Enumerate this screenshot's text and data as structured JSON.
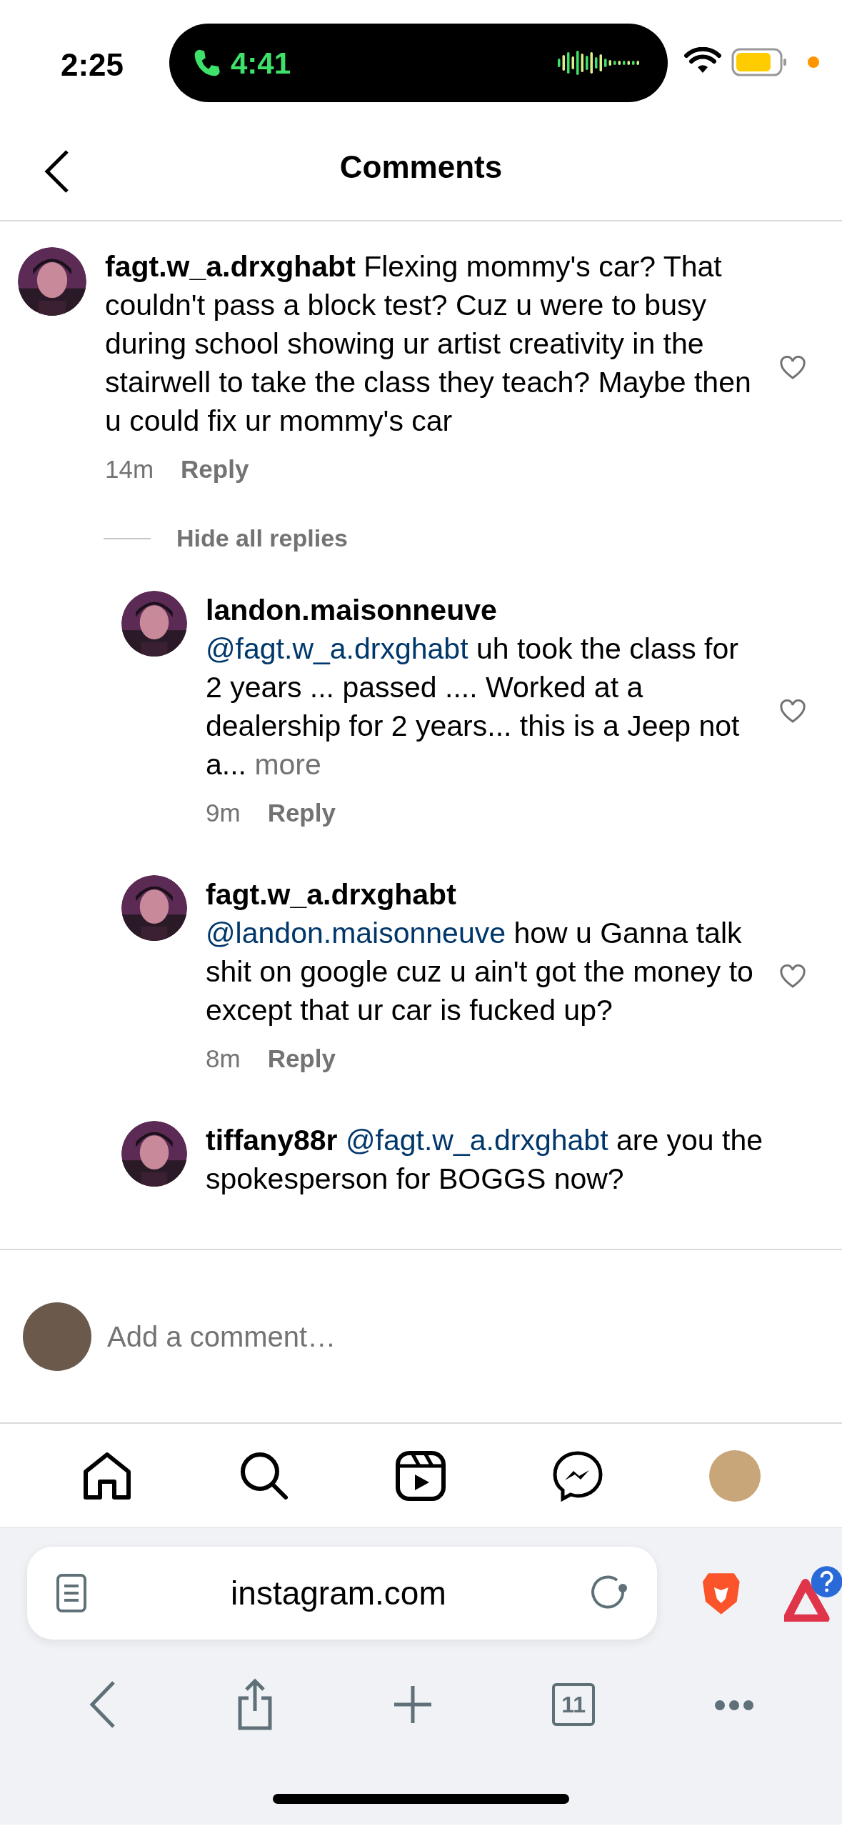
{
  "status_bar": {
    "time": "2:25",
    "call_timer": "4:41"
  },
  "header": {
    "title": "Comments"
  },
  "comments": [
    {
      "kind": "inline",
      "username": "fagt.w_a.drxghabt",
      "text": "Flexing mommy's car? That couldn't pass a block test? Cuz u were to busy during school showing ur artist creativity in the stairwell to take the class they teach? Maybe then u could fix ur mommy's car",
      "time": "14m",
      "reply_label": "Reply"
    }
  ],
  "replies_toggle": "Hide all replies",
  "replies": [
    {
      "kind": "stacked",
      "username": "landon.maisonneuve",
      "mention": "@fagt.w_a.drxghabt",
      "text": "uh took the class for 2 years ... passed .... Worked at a dealership for 2 years... this is a Jeep not a...",
      "more": "more",
      "time": "9m",
      "reply_label": "Reply"
    },
    {
      "kind": "stacked",
      "username": "fagt.w_a.drxghabt",
      "mention": "@landon.maisonneuve",
      "text": "how u Ganna talk shit on google cuz u ain't got the money to except that ur car is fucked up?",
      "time": "8m",
      "reply_label": "Reply"
    },
    {
      "kind": "inline",
      "username": "tiffany88r",
      "mention": "@fagt.w_a.drxghabt",
      "text": "are you the spokesperson for BOGGS now?"
    }
  ],
  "comment_input": {
    "placeholder": "Add a comment…"
  },
  "browser": {
    "url": "instagram.com",
    "tab_count": "11"
  }
}
